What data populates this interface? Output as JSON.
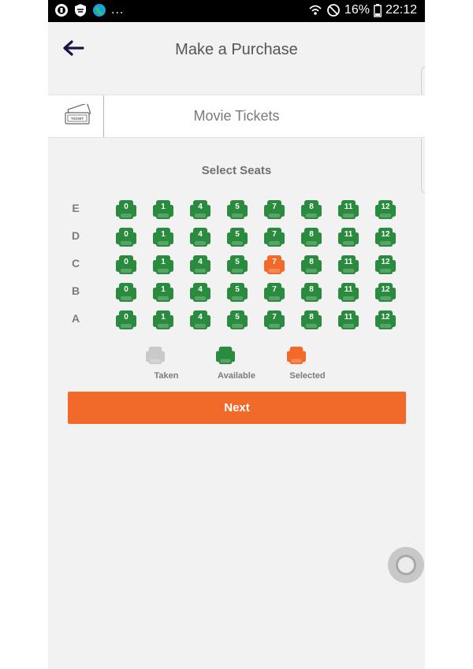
{
  "status_bar": {
    "battery": "16%",
    "time": "22:12",
    "more": "..."
  },
  "header": {
    "title": "Make a Purchase"
  },
  "product": {
    "name": "Movie Tickets",
    "icon_text": "TICKET"
  },
  "seating": {
    "title": "Select Seats",
    "rows": [
      "E",
      "D",
      "C",
      "B",
      "A"
    ],
    "seat_numbers": [
      "0",
      "1",
      "4",
      "5",
      "7",
      "8",
      "11",
      "12"
    ],
    "selected": [
      {
        "row": "C",
        "seat": "7"
      }
    ],
    "legend": [
      {
        "label": "Taken",
        "color": "#c9c9c9"
      },
      {
        "label": "Available",
        "color": "#2a8a3e"
      },
      {
        "label": "Selected",
        "color": "#f26a2a"
      }
    ]
  },
  "actions": {
    "next_label": "Next"
  },
  "colors": {
    "available": "#2a8a3e",
    "selected": "#f26a2a",
    "taken": "#c9c9c9",
    "accent": "#f26a2a"
  }
}
